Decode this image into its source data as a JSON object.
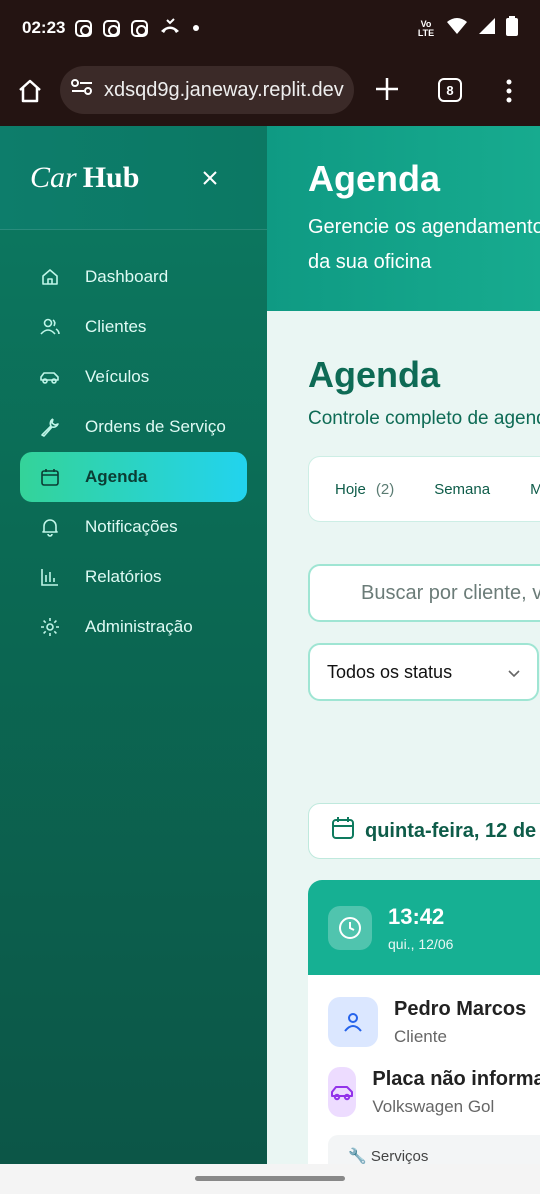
{
  "status_bar": {
    "time": "02:23",
    "network_label": "Vo LTE"
  },
  "browser": {
    "url": "xdsqd9g.janeway.replit.dev",
    "tab_count": "8"
  },
  "sidebar": {
    "brand_car": "Car",
    "brand_hub": "Hub",
    "items": [
      {
        "label": "Dashboard",
        "icon": "home-icon"
      },
      {
        "label": "Clientes",
        "icon": "users-icon"
      },
      {
        "label": "Veículos",
        "icon": "car-icon"
      },
      {
        "label": "Ordens de Serviço",
        "icon": "wrench-icon"
      },
      {
        "label": "Agenda",
        "icon": "calendar-icon",
        "active": true
      },
      {
        "label": "Notificações",
        "icon": "bell-icon"
      },
      {
        "label": "Relatórios",
        "icon": "bar-chart-icon"
      },
      {
        "label": "Administração",
        "icon": "gear-icon"
      }
    ]
  },
  "header": {
    "title": "Agenda",
    "subtitle": "Gerencie os agendamentos da sua oficina"
  },
  "section": {
    "title": "Agenda",
    "subtitle": "Controle completo de agendamentos"
  },
  "tabs": [
    {
      "label": "Hoje",
      "count": "(2)"
    },
    {
      "label": "Semana"
    },
    {
      "label": "M"
    }
  ],
  "search": {
    "placeholder": "Buscar por cliente, v"
  },
  "status_filter": {
    "selected": "Todos os status"
  },
  "date_heading": "quinta-feira, 12 de",
  "appointment": {
    "time": "13:42",
    "date": "qui., 12/06",
    "client_name": "Pedro Marcos",
    "client_label": "Cliente",
    "vehicle_plate": "Placa não informada",
    "vehicle_model": "Volkswagen Gol",
    "services_label": "Serviços"
  },
  "colors": {
    "sidebar_bg": "#0b6a54",
    "accent_gradient_start": "#34d399",
    "accent_gradient_end": "#22d3ee",
    "card_header": "#16b093",
    "title_color": "#0e6b55"
  }
}
